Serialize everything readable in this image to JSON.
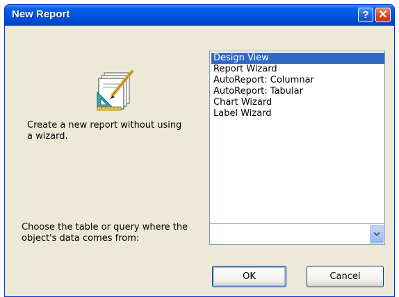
{
  "window": {
    "title": "New Report"
  },
  "titlebar": {
    "help_label": "?",
    "close_label": "✕"
  },
  "description": "Create a new report without using a wizard.",
  "report_types": [
    {
      "label": "Design View",
      "selected": true
    },
    {
      "label": "Report Wizard",
      "selected": false
    },
    {
      "label": "AutoReport:  Columnar",
      "selected": false
    },
    {
      "label": "AutoReport:  Tabular",
      "selected": false
    },
    {
      "label": "Chart Wizard",
      "selected": false
    },
    {
      "label": "Label Wizard",
      "selected": false
    }
  ],
  "source": {
    "prompt": "Choose the table or query where the object's data comes from:",
    "value": ""
  },
  "buttons": {
    "ok": "OK",
    "cancel": "Cancel"
  },
  "icons": {
    "report": "report-design-icon",
    "dropdown": "chevron-down-icon"
  },
  "colors": {
    "titlebar": "#0055e5",
    "selection": "#316ac5",
    "dialog_bg": "#ece9d8"
  }
}
